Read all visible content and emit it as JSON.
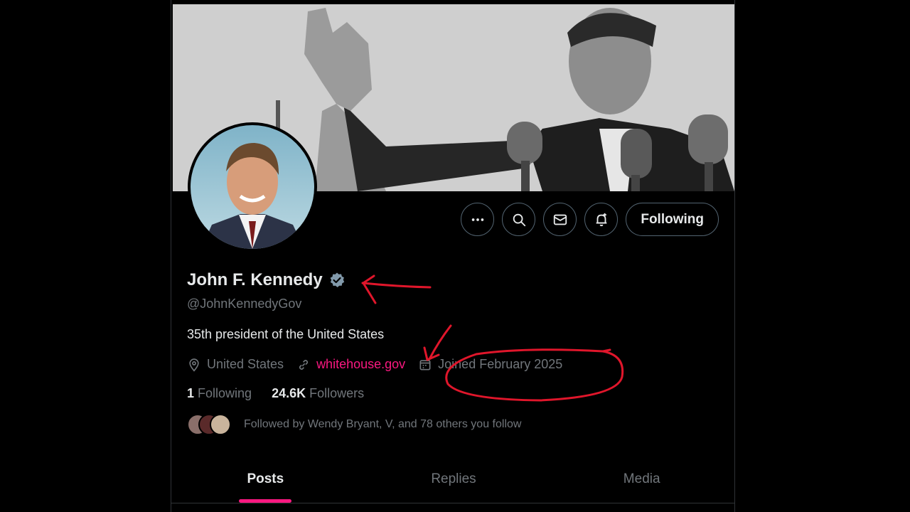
{
  "profile": {
    "name": "John F. Kennedy",
    "handle": "@JohnKennedyGov",
    "bio": "35th president of the United States",
    "location": "United States",
    "website": "whitehouse.gov",
    "joined": "Joined February 2025",
    "following_count": "1",
    "following_label": "Following",
    "followers_count": "24.6K",
    "followers_label": "Followers",
    "followed_by": "Followed by Wendy Bryant, V, and 78 others you follow"
  },
  "actions": {
    "more_icon": "more-horizontal-icon",
    "search_icon": "search-icon",
    "message_icon": "envelope-icon",
    "notify_icon": "bell-plus-icon",
    "following_button": "Following"
  },
  "tabs": [
    {
      "label": "Posts",
      "active": true
    },
    {
      "label": "Replies",
      "active": false
    },
    {
      "label": "Media",
      "active": false
    }
  ],
  "colors": {
    "background": "#000000",
    "accent": "#f91880",
    "verified": "#829aab",
    "annotation": "#e0162b"
  }
}
